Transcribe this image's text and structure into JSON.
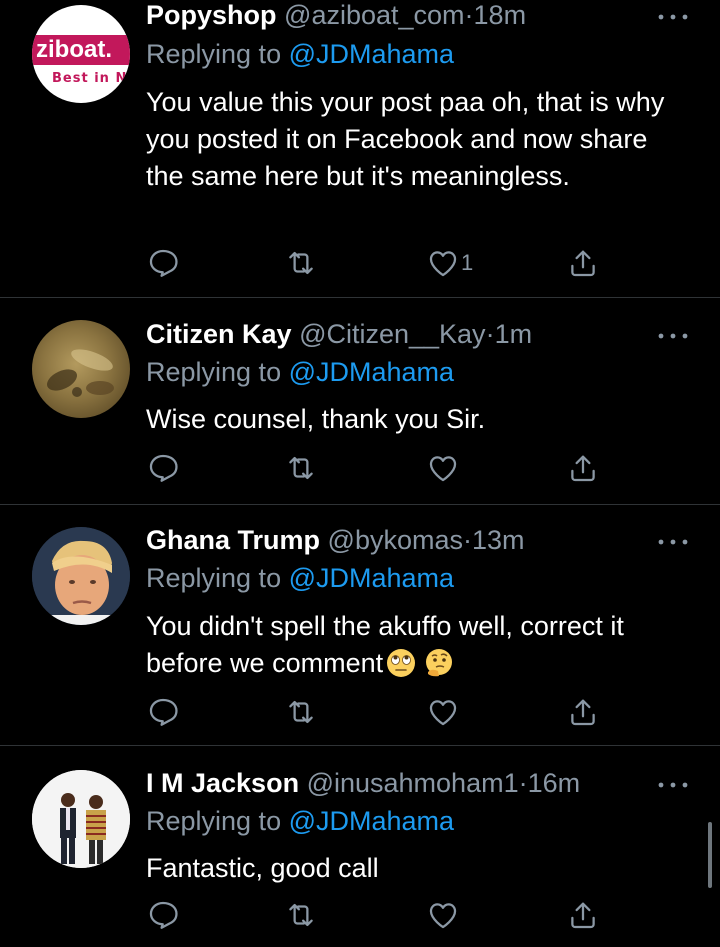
{
  "colors": {
    "background": "#000000",
    "text": "#ffffff",
    "secondary": "#8b98a5",
    "mention": "#1d9bf0",
    "divider": "#2f3336"
  },
  "tweets": [
    {
      "name": "Popyshop",
      "handle": "@aziboat_com",
      "dot": "·",
      "time": "18m",
      "reply_prefix": "Replying to",
      "reply_to": "@JDMahama",
      "text": "You value this your post paa oh, that is why you posted it on Facebook and now share the same here but it's meaningless.",
      "avatar": {
        "logo_text": "ziboat.",
        "tagline": "Best in N"
      },
      "like_count": "1"
    },
    {
      "name": "Citizen Kay",
      "handle": "@Citizen__Kay",
      "dot": "·",
      "time": "1m",
      "reply_prefix": "Replying to",
      "reply_to": "@JDMahama",
      "text": "Wise counsel, thank you Sir.",
      "like_count": ""
    },
    {
      "name": "Ghana Trump",
      "handle": "@bykomas",
      "dot": "·",
      "time": "13m",
      "reply_prefix": "Replying to",
      "reply_to": "@JDMahama",
      "text": "You didn't spell the akuffo well, correct it before we comment",
      "emojis": [
        "face-with-rolling-eyes",
        "thinking-face"
      ],
      "like_count": ""
    },
    {
      "name": "I M Jackson",
      "handle": "@inusahmoham1",
      "dot": "·",
      "time": "16m",
      "reply_prefix": "Replying to",
      "reply_to": "@JDMahama",
      "text": "Fantastic, good call",
      "like_count": ""
    }
  ],
  "icons": [
    "more-icon",
    "reply-icon",
    "retweet-icon",
    "like-icon",
    "share-icon"
  ]
}
